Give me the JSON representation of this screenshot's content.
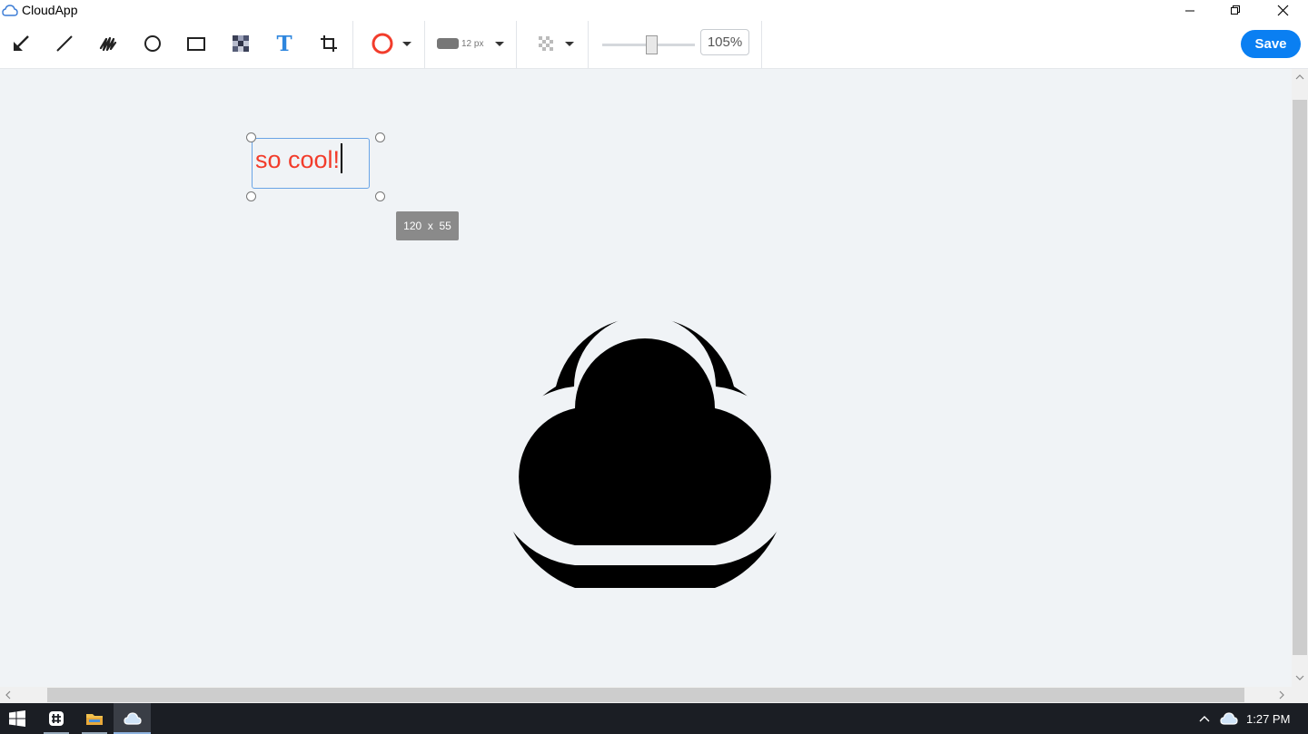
{
  "window": {
    "title": "CloudApp",
    "minimize_icon": "minimize-icon",
    "restore_icon": "restore-icon",
    "close_icon": "close-icon"
  },
  "toolbar": {
    "tools": [
      {
        "name": "arrow-tool",
        "icon": "arrow-icon"
      },
      {
        "name": "line-tool",
        "icon": "line-icon"
      },
      {
        "name": "freehand-tool",
        "icon": "scribble-icon"
      },
      {
        "name": "ellipse-tool",
        "icon": "ellipse-icon"
      },
      {
        "name": "rectangle-tool",
        "icon": "rectangle-icon"
      },
      {
        "name": "pixelate-tool",
        "icon": "pixelate-icon"
      },
      {
        "name": "text-tool",
        "icon": "text-icon",
        "active": true,
        "label": "T"
      },
      {
        "name": "crop-tool",
        "icon": "crop-icon"
      }
    ],
    "color": {
      "value": "#f23c2b",
      "icon": "color-circle-icon"
    },
    "stroke_size_label": "12 px",
    "opacity_icon": "checkerboard-icon",
    "zoom": {
      "value": "105%",
      "slider_fraction": 0.53
    },
    "save_label": "Save",
    "accent": "#0a7ff2"
  },
  "canvas": {
    "text_annotation": "so cool!",
    "text_color": "#f23c2b",
    "dimension_tooltip": "120  x  55",
    "logo": "cloudapp-logo"
  },
  "taskbar": {
    "start_icon": "windows-start-icon",
    "apps": [
      {
        "name": "slack-app",
        "icon": "slack-icon"
      },
      {
        "name": "file-explorer",
        "icon": "folder-icon"
      },
      {
        "name": "cloudapp",
        "icon": "cloud-icon",
        "active": true
      }
    ],
    "tray_icons": [
      "chevron-up-icon",
      "cloud-icon"
    ],
    "clock": "1:27 PM"
  }
}
